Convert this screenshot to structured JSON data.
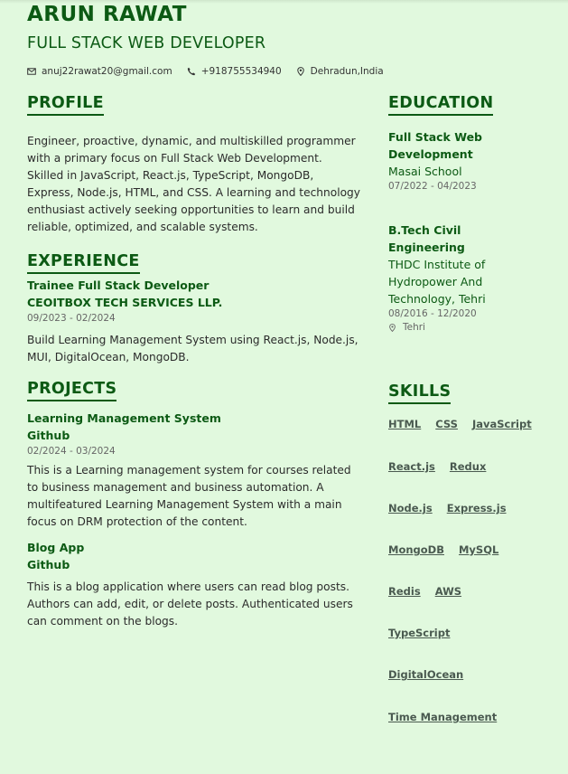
{
  "header": {
    "name": "ARUN RAWAT",
    "role": "FULL STACK WEB DEVELOPER",
    "email": "anuj22rawat20@gmail.com",
    "phone": "+918755534940",
    "location": "Dehradun,India"
  },
  "profile": {
    "title": "PROFILE",
    "text": "Engineer, proactive, dynamic, and multiskilled programmer with a primary focus on Full Stack Web Development. Skilled in JavaScript, React.js, TypeScript, MongoDB, Express, Node.js, HTML, and CSS. A learning and technology enthusiast actively seeking opportunities to learn and build reliable, optimized, and scalable systems."
  },
  "experience": {
    "title": "EXPERIENCE",
    "items": [
      {
        "role": "Trainee Full Stack Developer",
        "company": "CEOITBOX TECH SERVICES LLP.",
        "dates": "09/2023 - 02/2024",
        "description": "Build Learning Management System using React.js, Node.js, MUI, DigitalOcean, MongoDB."
      }
    ]
  },
  "projects": {
    "title": "PROJECTS",
    "items": [
      {
        "name": "Learning Management System",
        "link": "Github",
        "dates": "02/2024 - 03/2024",
        "description": "This is a Learning management system for courses related to business management and business automation. A multifeatured Learning Management System with a main focus on DRM protection of the content."
      },
      {
        "name": "Blog App",
        "link": "Github",
        "description": "This is a blog application where users can read blog posts. Authors can add, edit, or delete posts. Authenticated users can comment on the blogs."
      }
    ]
  },
  "education": {
    "title": "EDUCATION",
    "items": [
      {
        "degree": "Full Stack Web Development",
        "school": "Masai School",
        "dates": "07/2022 - 04/2023"
      },
      {
        "degree": "B.Tech Civil Engineering",
        "school": "THDC Institute of Hydropower And Technology, Tehri",
        "dates": "08/2016 - 12/2020",
        "location": "Tehri"
      }
    ]
  },
  "skills": {
    "title": "SKILLS",
    "rows": [
      [
        "HTML",
        "CSS",
        "JavaScript"
      ],
      [
        "React.js",
        "Redux"
      ],
      [
        "Node.js",
        "Express.js"
      ],
      [
        "MongoDB",
        "MySQL"
      ],
      [
        "Redis",
        "AWS"
      ],
      [
        "TypeScript"
      ],
      [
        "DigitalOcean"
      ],
      [
        "Time Management"
      ]
    ]
  },
  "icons": {
    "email": "envelope-icon",
    "phone": "phone-icon",
    "location": "map-pin-icon"
  },
  "colors": {
    "background": "#e1f9de",
    "accent": "#0c5a14",
    "text": "#2b2b2b",
    "muted": "#666666",
    "skill": "#4a5a50"
  }
}
